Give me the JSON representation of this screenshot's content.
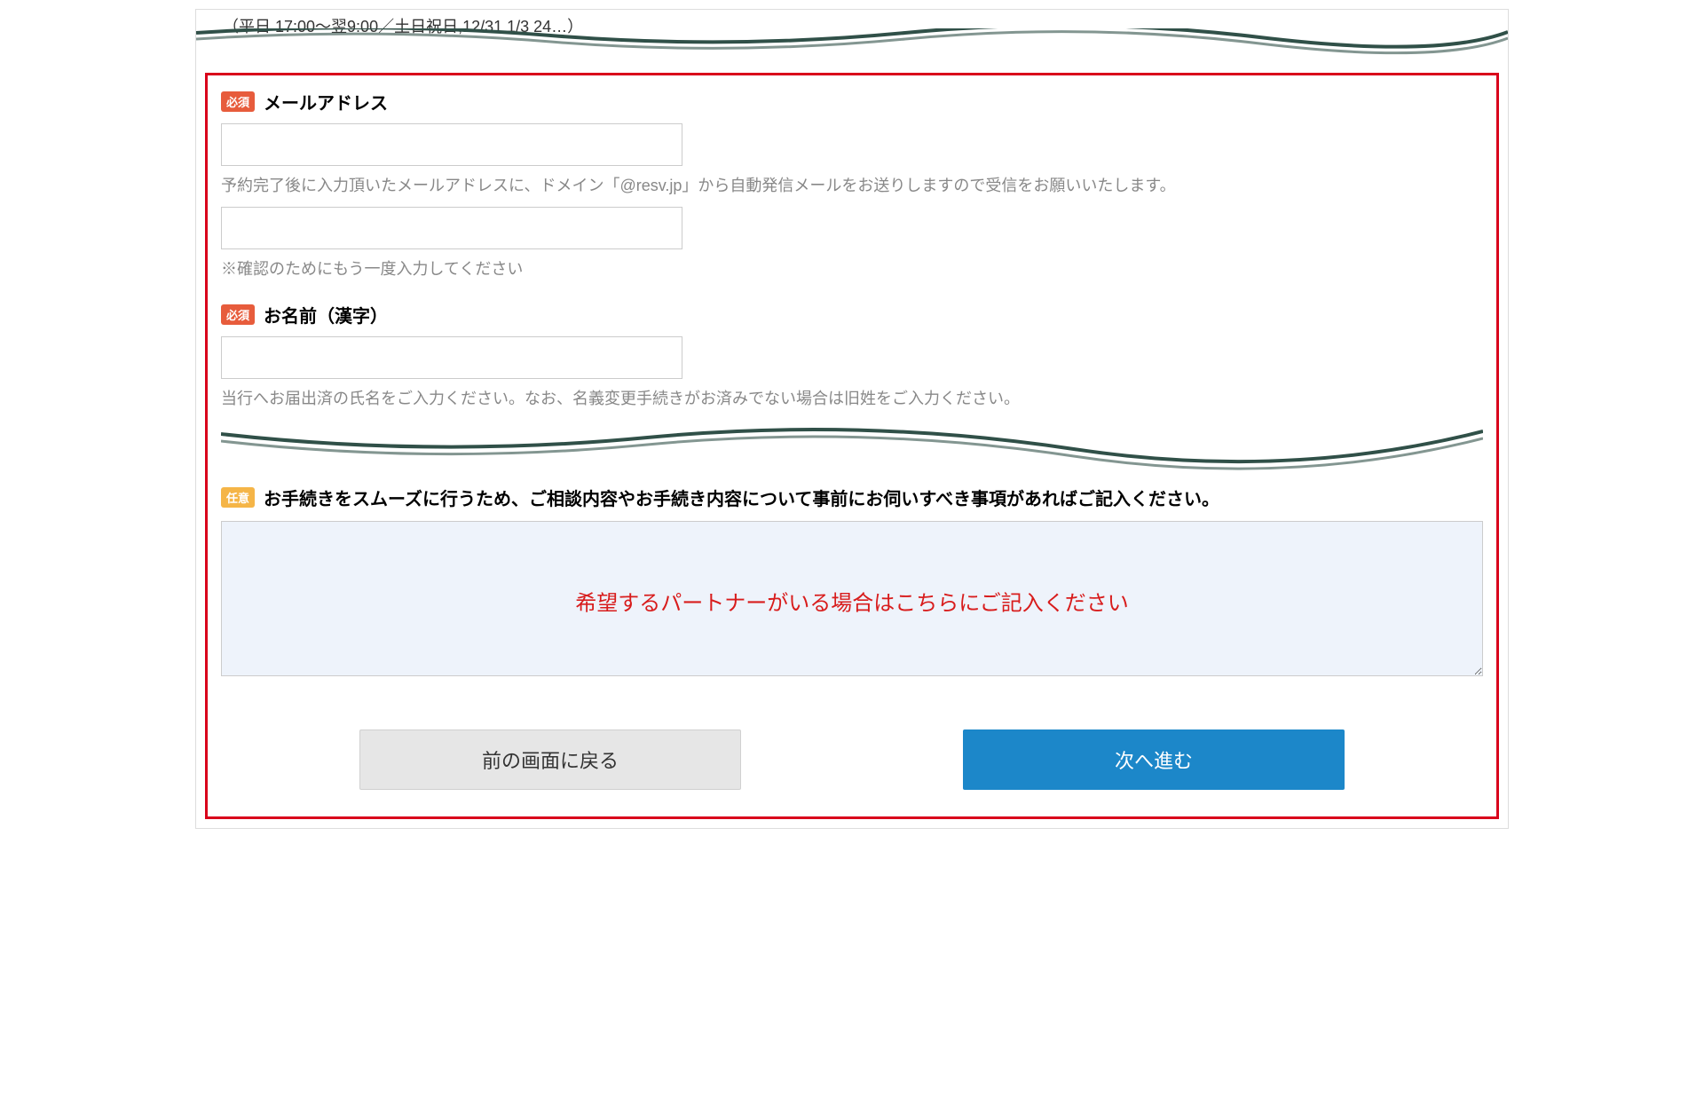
{
  "hours": "（平日 17:00～翌9:00／土日祝日,12/31  1/3  24…）",
  "fields": {
    "email": {
      "badge": "必須",
      "label": "メールアドレス",
      "help1": "予約完了後に入力頂いたメールアドレスに、ドメイン「@resv.jp」から自動発信メールをお送りしますので受信をお願いいたします。",
      "help2": "※確認のためにもう一度入力してください"
    },
    "name": {
      "badge": "必須",
      "label": "お名前（漢字）",
      "help": "当行へお届出済の氏名をご入力ください。なお、名義変更手続きがお済みでない場合は旧姓をご入力ください。"
    },
    "notes": {
      "badge": "任意",
      "label": "お手続きをスムーズに行うため、ご相談内容やお手続き内容について事前にお伺いすべき事項があればご記入ください。",
      "callout": "希望するパートナーがいる場合はこちらにご記入ください"
    }
  },
  "buttons": {
    "back": "前の画面に戻る",
    "next": "次へ進む"
  }
}
